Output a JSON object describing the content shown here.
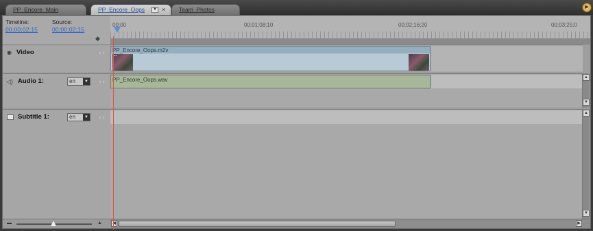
{
  "tabs": [
    {
      "label": "PP_Encore_Main",
      "active": false
    },
    {
      "label": "PP_Encore_Oops",
      "active": true
    },
    {
      "label": "Team_Photos",
      "active": false
    }
  ],
  "header": {
    "timeline_label": "Timeline:",
    "source_label": "Source:",
    "timeline_tc": "00;00;02;15",
    "source_tc": "00;00;02;15"
  },
  "ruler": {
    "labels": [
      "00;00",
      "00;01;08;10",
      "00;02;16;20",
      "00;03;25;0"
    ]
  },
  "tracks": {
    "video": {
      "name": "Video",
      "clip": "PP_Encore_Oops.m2v"
    },
    "audio": {
      "name": "Audio 1:",
      "lang": "en",
      "clip": "PP_Encore_Oops.wav"
    },
    "subtitle": {
      "name": "Subtitle 1:",
      "lang": "en"
    }
  },
  "colors": {
    "timecode": "#2a63c9",
    "playhead": "#e0553a",
    "video_clip": "#b7cad6",
    "audio_clip": "#a8b69a",
    "panel_bg": "#9e9e9e"
  }
}
